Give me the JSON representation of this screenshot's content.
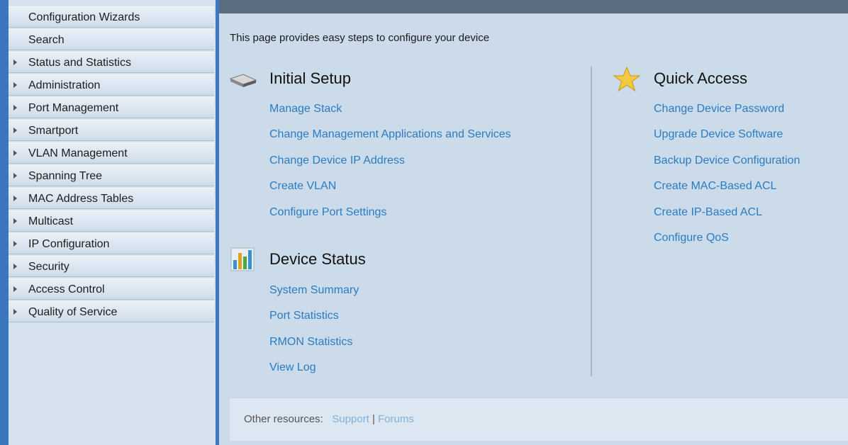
{
  "sidebar": {
    "items": [
      {
        "label": "Configuration Wizards",
        "expandable": false
      },
      {
        "label": "Search",
        "expandable": false
      },
      {
        "label": "Status and Statistics",
        "expandable": true
      },
      {
        "label": "Administration",
        "expandable": true
      },
      {
        "label": "Port Management",
        "expandable": true
      },
      {
        "label": "Smartport",
        "expandable": true
      },
      {
        "label": "VLAN Management",
        "expandable": true
      },
      {
        "label": "Spanning Tree",
        "expandable": true
      },
      {
        "label": "MAC Address Tables",
        "expandable": true
      },
      {
        "label": "Multicast",
        "expandable": true
      },
      {
        "label": "IP Configuration",
        "expandable": true
      },
      {
        "label": "Security",
        "expandable": true
      },
      {
        "label": "Access Control",
        "expandable": true
      },
      {
        "label": "Quality of Service",
        "expandable": true
      }
    ]
  },
  "main": {
    "intro": "This page provides easy steps to configure your device",
    "initial_setup": {
      "icon": "switch-device-icon",
      "title": "Initial Setup",
      "links": [
        "Manage Stack",
        "Change Management Applications and Services",
        "Change Device IP Address",
        "Create VLAN",
        "Configure Port Settings"
      ]
    },
    "device_status": {
      "icon": "bar-chart-icon",
      "title": "Device Status",
      "links": [
        "System Summary",
        "Port Statistics",
        "RMON Statistics",
        "View Log"
      ]
    },
    "quick_access": {
      "icon": "star-icon",
      "title": "Quick Access",
      "links": [
        "Change Device Password",
        "Upgrade Device Software",
        "Backup Device Configuration",
        "Create MAC-Based ACL",
        "Create IP-Based ACL",
        "Configure QoS"
      ]
    },
    "footer": {
      "label": "Other resources:",
      "support": "Support",
      "separator": "|",
      "forums": "Forums"
    }
  },
  "colors": {
    "link": "#2a7cc2",
    "sidebar_accent": "#3a76bd",
    "header_bar": "#5a6e80"
  }
}
